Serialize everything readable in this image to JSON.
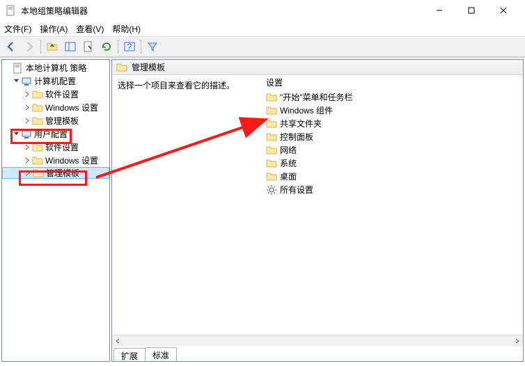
{
  "window": {
    "title": "本地组策略编辑器"
  },
  "menubar": {
    "file": "文件(F)",
    "action": "操作(A)",
    "view": "查看(V)",
    "help": "帮助(H)"
  },
  "tree": {
    "root": "本地计算机 策略",
    "computer": "计算机配置",
    "computer_children": {
      "software": "软件设置",
      "windows": "Windows 设置",
      "admin": "管理模板"
    },
    "user": "用户配置",
    "user_children": {
      "software": "软件设置",
      "windows": "Windows 设置",
      "admin": "管理模板"
    }
  },
  "rightpane": {
    "header": "管理模板",
    "prompt": "选择一个项目来查看它的描述。",
    "col_setting": "设置",
    "items": [
      {
        "label": "\"开始\"菜单和任务栏",
        "icon": "folder"
      },
      {
        "label": "Windows 组件",
        "icon": "folder"
      },
      {
        "label": "共享文件夹",
        "icon": "folder"
      },
      {
        "label": "控制面板",
        "icon": "folder"
      },
      {
        "label": "网络",
        "icon": "folder"
      },
      {
        "label": "系统",
        "icon": "folder"
      },
      {
        "label": "桌面",
        "icon": "folder"
      },
      {
        "label": "所有设置",
        "icon": "settings"
      }
    ],
    "tabs": {
      "extended": "扩展",
      "standard": "标准"
    }
  }
}
